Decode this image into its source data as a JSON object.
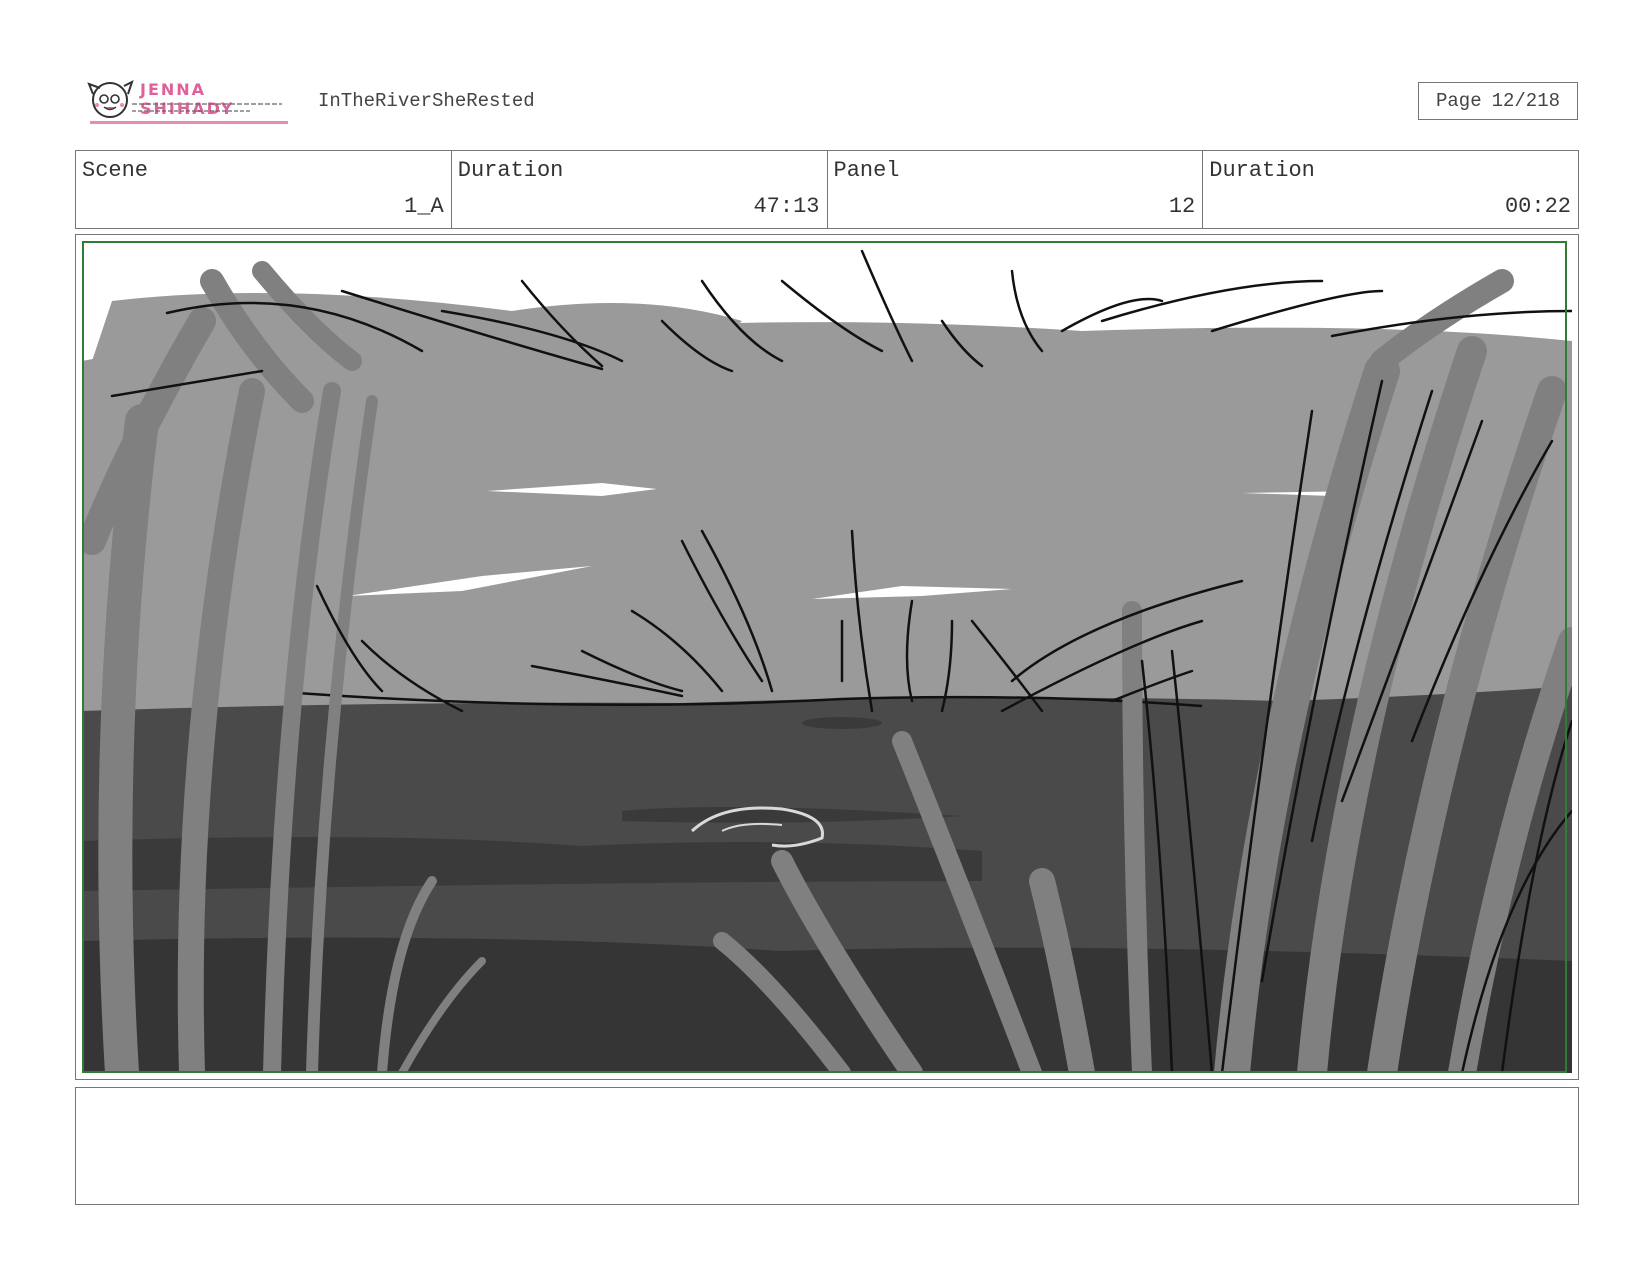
{
  "header": {
    "logo_text": "JENNA SHIHADY",
    "project_title": "InTheRiverSheRested",
    "page_label": "Page",
    "page_value": "12/218"
  },
  "info": {
    "scene_label": "Scene",
    "scene_value": "1_A",
    "duration_label": "Duration",
    "duration_value": "47:13",
    "panel_label": "Panel",
    "panel_value": "12",
    "panel_duration_label": "Duration",
    "panel_duration_value": "00:22"
  },
  "colors": {
    "logo_pink": "#e0609a",
    "safe_frame_green": "#2e7d32",
    "sky_grey": "#9a9a9a",
    "water_dark": "#4a4a4a",
    "grass_grey": "#808080"
  },
  "notes": {
    "text": ""
  }
}
